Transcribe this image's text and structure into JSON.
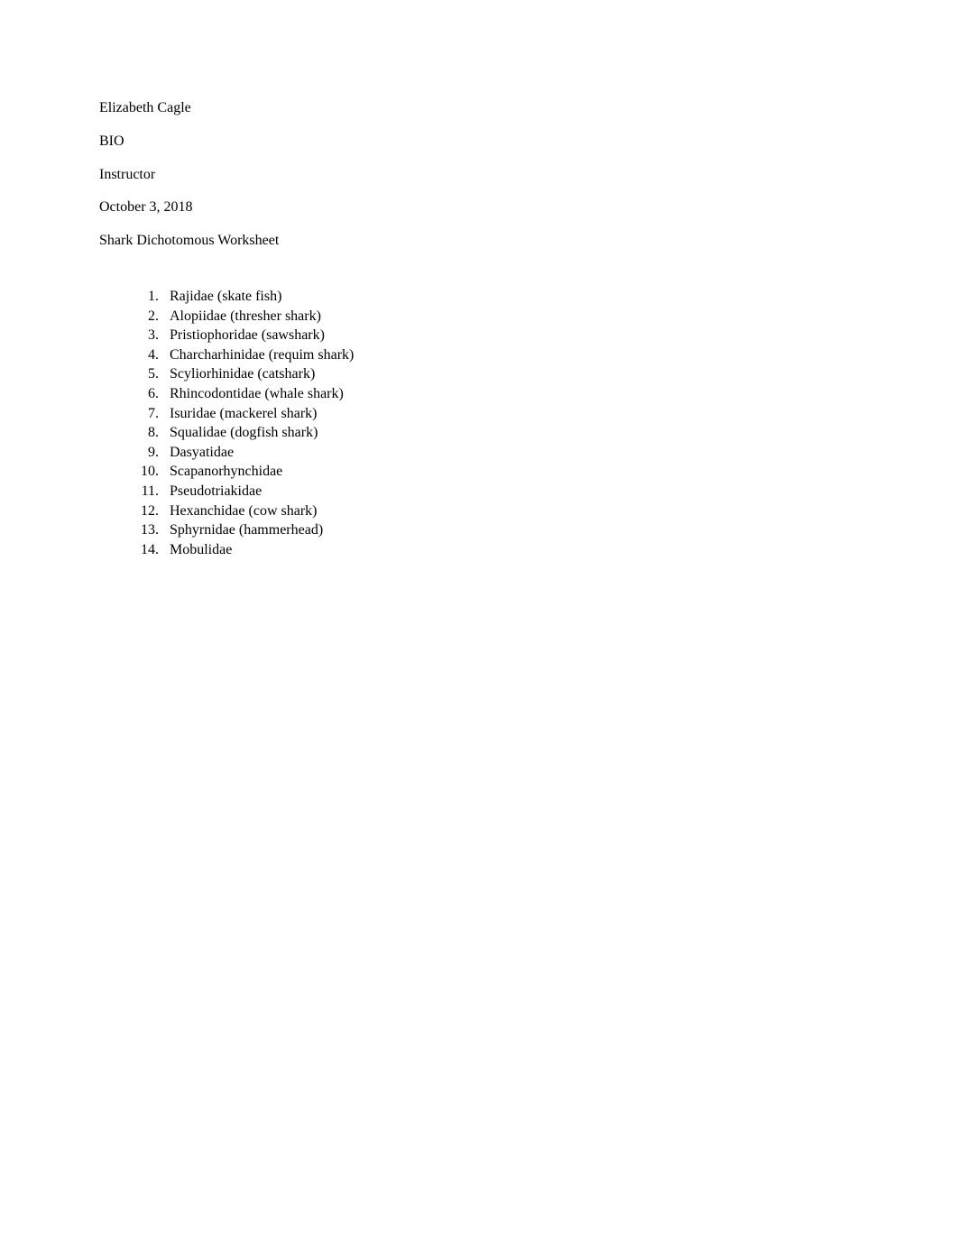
{
  "header": {
    "name": "Elizabeth Cagle",
    "course": "BIO",
    "instructor": "Instructor",
    "date": "October 3, 2018",
    "title": "Shark Dichotomous Worksheet"
  },
  "list": {
    "items": [
      "Rajidae (skate fish)",
      "Alopiidae (thresher shark)",
      "Pristiophoridae (sawshark)",
      "Charcharhinidae (requim shark)",
      "Scyliorhinidae (catshark)",
      "Rhincodontidae (whale shark)",
      "Isuridae (mackerel shark)",
      "Squalidae (dogfish shark)",
      "Dasyatidae",
      "Scapanorhynchidae",
      "Pseudotriakidae",
      "Hexanchidae (cow shark)",
      "Sphyrnidae (hammerhead)",
      "Mobulidae"
    ]
  }
}
